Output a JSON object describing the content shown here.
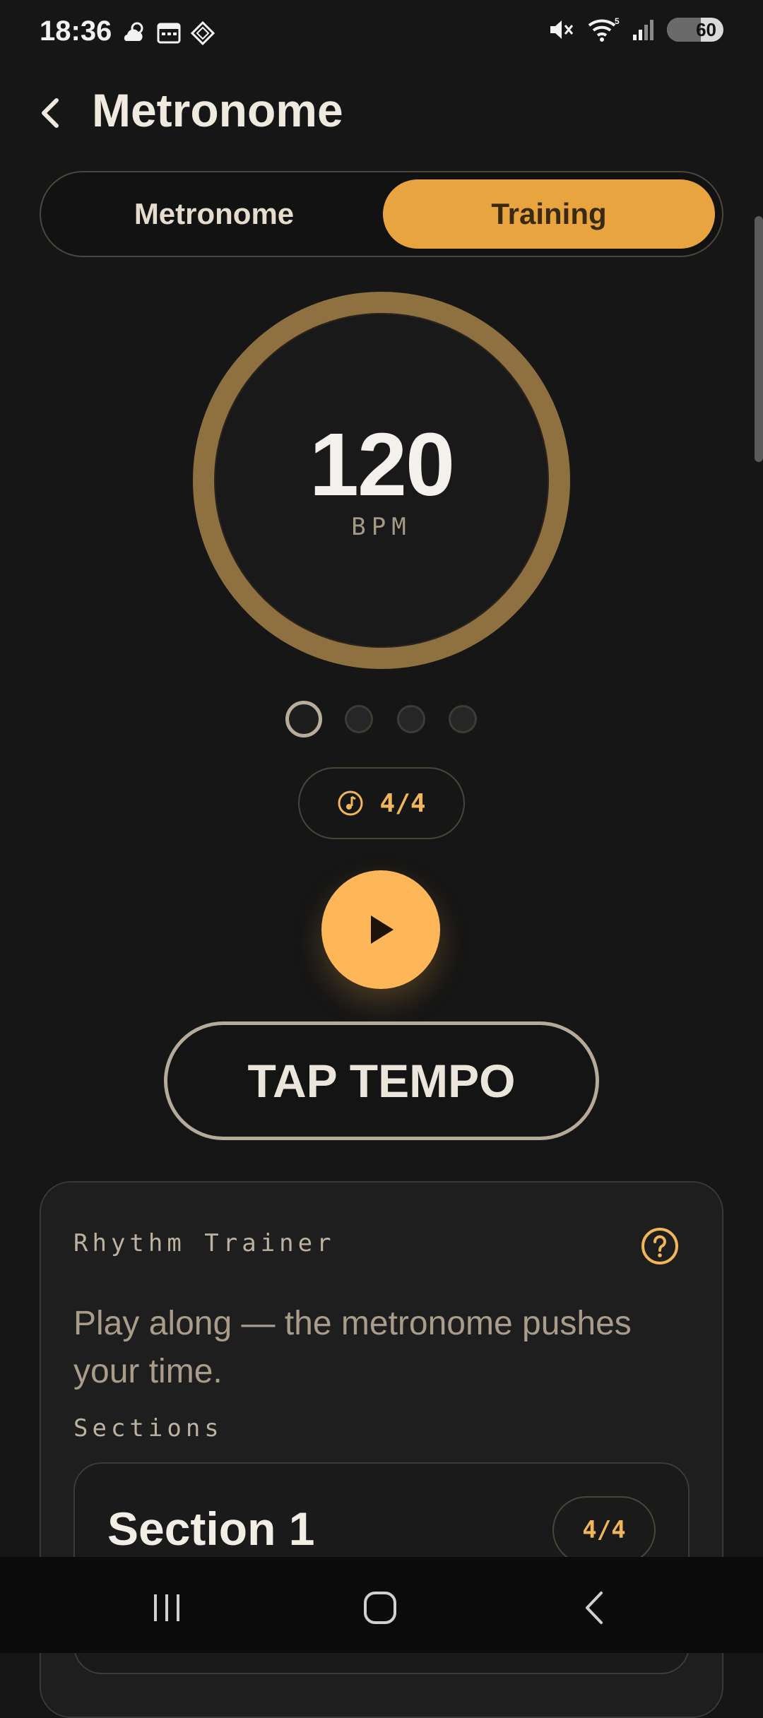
{
  "status_bar": {
    "time": "18:36",
    "battery": "60",
    "left_icons": [
      "weather-cloud-sun-icon",
      "calendar-icon",
      "app-diamond-icon"
    ],
    "right_icons": [
      "mute-icon",
      "wifi-icon",
      "signal-icon",
      "battery-icon"
    ],
    "wifi_badge": "5"
  },
  "header": {
    "title": "Metronome",
    "back_icon": "chevron-left-icon"
  },
  "mode_toggle": {
    "options": [
      "Metronome",
      "Training"
    ],
    "selected": "Training"
  },
  "dial": {
    "bpm": "120",
    "unit": "BPM"
  },
  "beats": {
    "count": 4,
    "active_index": 0
  },
  "time_signature": {
    "label": "4/4",
    "icon": "music-note-icon"
  },
  "play": {
    "icon": "play-icon"
  },
  "tap_tempo": {
    "label": "TAP TEMPO"
  },
  "trainer": {
    "title": "Rhythm Trainer",
    "description": "Play along — the metronome pushes your time.",
    "sections_label": "Sections",
    "sections": [
      {
        "name": "Section 1",
        "time_signature": "4/4"
      }
    ]
  },
  "nav_bar": {
    "buttons": [
      "recent-apps-icon",
      "home-icon",
      "back-icon"
    ]
  },
  "colors": {
    "background": "#161616",
    "accent": "#e8a53f",
    "accent_light": "#fdb758",
    "dial_ring": "#8f7141"
  }
}
